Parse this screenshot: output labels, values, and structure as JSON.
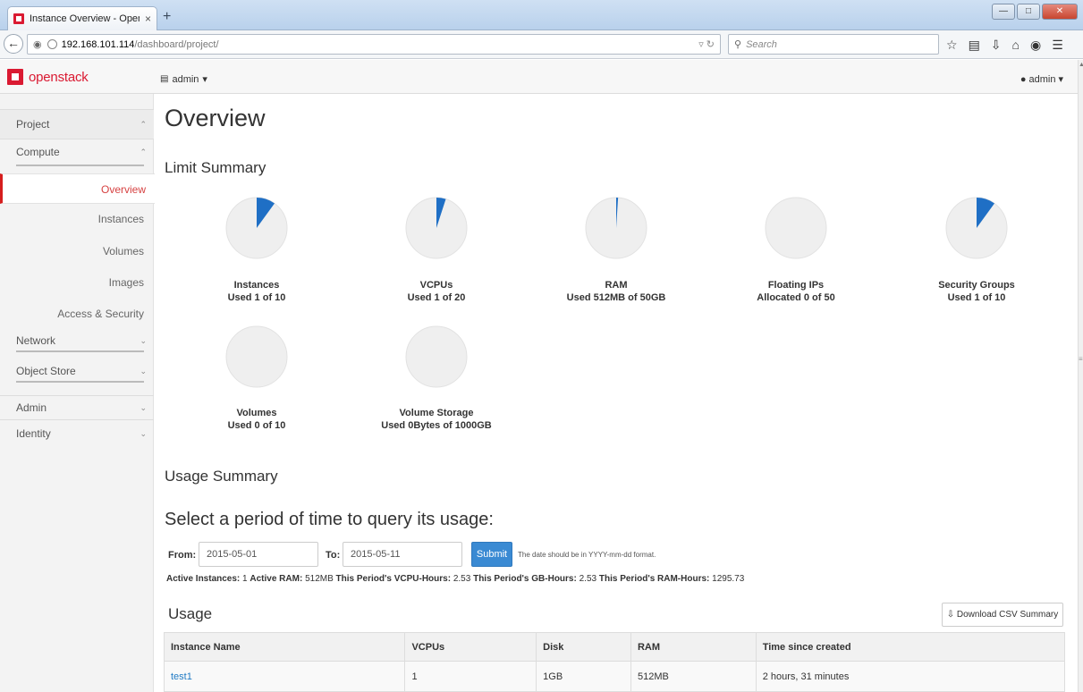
{
  "browser": {
    "tab_title": "Instance Overview - OpenS...",
    "tab_close": "×",
    "new_tab": "+",
    "url_host": "192.168.101.114",
    "url_path": "/dashboard/project/",
    "search_placeholder": "Search"
  },
  "header": {
    "brand": "openstack",
    "project_selector": "admin",
    "user_menu": "admin"
  },
  "sidebar": {
    "project": "Project",
    "compute": "Compute",
    "items": [
      {
        "label": "Overview"
      },
      {
        "label": "Instances"
      },
      {
        "label": "Volumes"
      },
      {
        "label": "Images"
      },
      {
        "label": "Access & Security"
      }
    ],
    "network": "Network",
    "object_store": "Object Store",
    "admin": "Admin",
    "identity": "Identity"
  },
  "main": {
    "title": "Overview",
    "limit_summary": "Limit Summary",
    "usage_summary": "Usage Summary",
    "query_heading": "Select a period of time to query its usage:",
    "from_label": "From:",
    "from_value": "2015-05-01",
    "to_label": "To:",
    "to_value": "2015-05-11",
    "submit_label": "Submit",
    "date_hint": "The date should be in YYYY-mm-dd format.",
    "stats": {
      "active_instances_label": "Active Instances:",
      "active_instances": "1",
      "active_ram_label": "Active RAM:",
      "active_ram": "512MB",
      "vcpu_hours_label": "This Period's VCPU-Hours:",
      "vcpu_hours": "2.53",
      "gb_hours_label": "This Period's GB-Hours:",
      "gb_hours": "2.53",
      "ram_hours_label": "This Period's RAM-Hours:",
      "ram_hours": "1295.73"
    },
    "usage_heading": "Usage",
    "csv_button": "Download CSV Summary",
    "table": {
      "headers": [
        "Instance Name",
        "VCPUs",
        "Disk",
        "RAM",
        "Time since created"
      ],
      "rows": [
        [
          "test1",
          "1",
          "1GB",
          "512MB",
          "2 hours, 31 minutes"
        ]
      ]
    }
  },
  "limits": [
    {
      "name": "Instances",
      "detail": "Used 1 of 10",
      "fraction": 0.1
    },
    {
      "name": "VCPUs",
      "detail": "Used 1 of 20",
      "fraction": 0.05
    },
    {
      "name": "RAM",
      "detail": "Used 512MB of 50GB",
      "fraction": 0.01
    },
    {
      "name": "Floating IPs",
      "detail": "Allocated 0 of 50",
      "fraction": 0
    },
    {
      "name": "Security Groups",
      "detail": "Used 1 of 10",
      "fraction": 0.1
    },
    {
      "name": "Volumes",
      "detail": "Used 0 of 10",
      "fraction": 0
    },
    {
      "name": "Volume Storage",
      "detail": "Used 0Bytes of 1000GB",
      "fraction": 0
    }
  ],
  "colors": {
    "pie_used": "#1f6fc5",
    "pie_free": "#efefef",
    "brand_red": "#da1a32",
    "accent_blue": "#3a8ad3"
  }
}
